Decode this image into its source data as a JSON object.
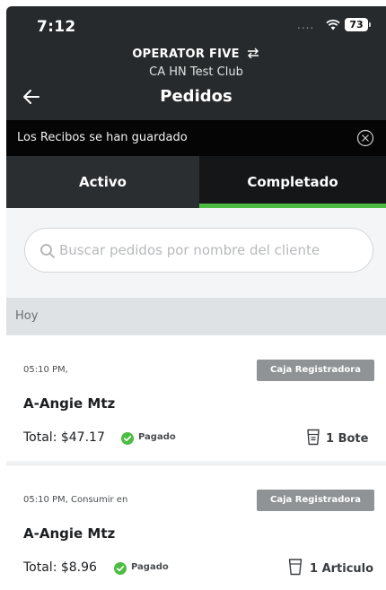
{
  "status_bar": {
    "time": "7:12",
    "signal": "....",
    "battery": "73"
  },
  "header": {
    "operator": "OPERATOR FIVE",
    "club": "CA HN Test Club",
    "title": "Pedidos"
  },
  "toast": {
    "message": "Los Recibos se han guardado"
  },
  "tabs": [
    {
      "label": "Activo",
      "selected": false
    },
    {
      "label": "Completado",
      "selected": true
    }
  ],
  "search": {
    "placeholder": "Buscar pedidos por nombre del cliente",
    "value": ""
  },
  "section": {
    "label": "Hoy"
  },
  "orders": [
    {
      "time": "05:10 PM,",
      "channel": "Caja Registradora",
      "customer": "A-Angie Mtz",
      "total": "Total: $47.17",
      "status": "Pagado",
      "count": "1 Bote",
      "count_icon": "bucket-icon"
    },
    {
      "time": "05:10 PM, Consumir en",
      "channel": "Caja Registradora",
      "customer": "A-Angie Mtz",
      "total": "Total: $8.96",
      "status": "Pagado",
      "count": "1 Articulo",
      "count_icon": "cup-icon"
    }
  ],
  "colors": {
    "header_bg": "#272a2d",
    "accent": "#4cbc43",
    "badge_bg": "#8f9396"
  }
}
